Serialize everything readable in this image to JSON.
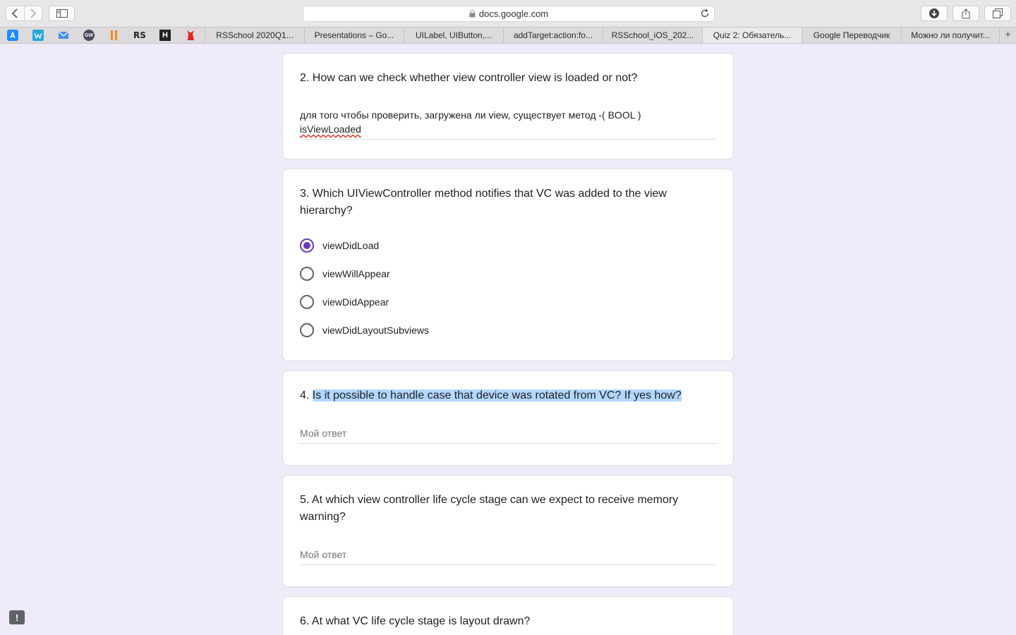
{
  "browser": {
    "url": "docs.google.com",
    "tabs": [
      {
        "label": "RSSchool 2020Q1..."
      },
      {
        "label": "Presentations – Go..."
      },
      {
        "label": "UILabel, UIButton,..."
      },
      {
        "label": "addTarget:action:fo..."
      },
      {
        "label": "RSSchool_iOS_202..."
      },
      {
        "label": "Quiz 2: Обязатель...",
        "active": true
      },
      {
        "label": "Google Переводчик"
      },
      {
        "label": "Можно ли получит..."
      }
    ],
    "bookmark_icons": [
      "app-store-icon",
      "wikipedia-icon",
      "mail-icon",
      "gw-icon",
      "pause-icon",
      "rs-icon",
      "habr-icon",
      "cat-icon"
    ],
    "bookmark_texts": {
      "gw": "GW",
      "rs": "RS",
      "habr": "H"
    }
  },
  "form": {
    "q2": {
      "title": "2. How can we check whether view controller view is loaded or not?",
      "answer_line1": "для того чтобы проверить, загружена ли view, существует метод -( BOOL )",
      "answer_line2": "isViewLoaded"
    },
    "q3": {
      "title": "3. Which UIViewController method notifies that VC was added to the view hierarchy?",
      "options": [
        "viewDidLoad",
        "viewWillAppear",
        "viewDidAppear",
        "viewDidLayoutSubviews"
      ],
      "selected": "viewDidLoad"
    },
    "q4": {
      "number": "4.",
      "title_text": "Is it possible to handle case that device was rotated from VC? If yes how?",
      "placeholder": "Мой ответ"
    },
    "q5": {
      "title": "5. At which view controller life cycle stage can we expect to receive memory warning?",
      "placeholder": "Мой ответ"
    },
    "q6": {
      "title": "6. At what VC life cycle stage is layout drawn?"
    }
  },
  "colors": {
    "accent": "#673ab7",
    "background": "#f0ebf8",
    "selection": "#b3d7ff"
  }
}
